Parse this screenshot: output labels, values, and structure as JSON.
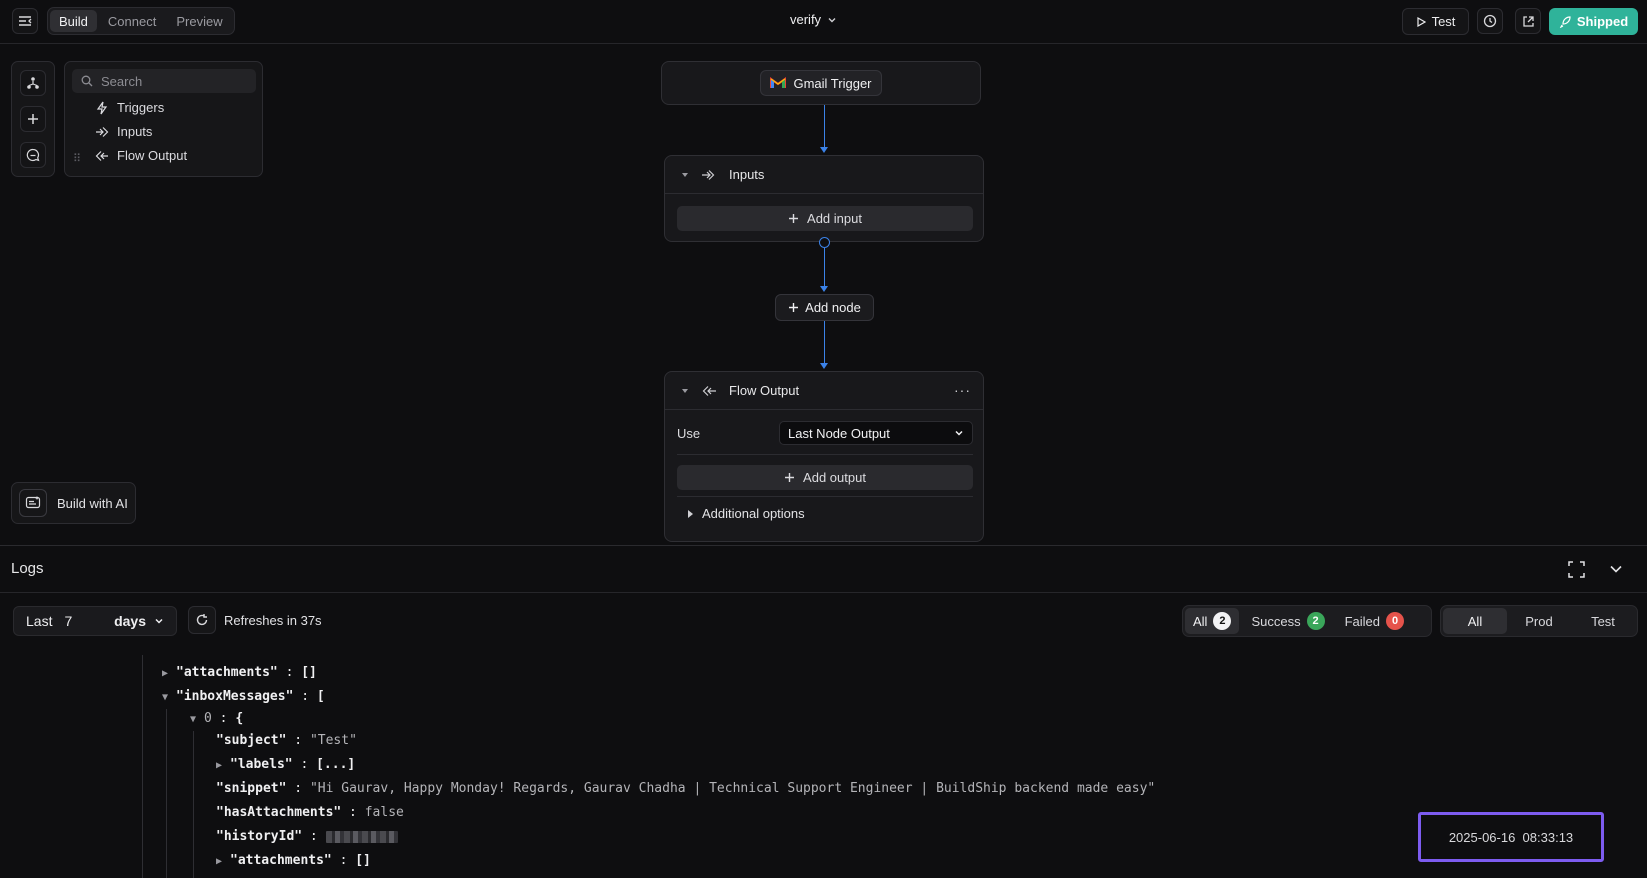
{
  "topbar": {
    "tabs": [
      "Build",
      "Connect",
      "Preview"
    ],
    "active_tab": "Build",
    "flow_name": "verify",
    "test_label": "Test",
    "shipped_label": "Shipped"
  },
  "sidebar": {
    "search_placeholder": "Search",
    "items": [
      {
        "label": "Triggers",
        "icon": "bolt-icon"
      },
      {
        "label": "Inputs",
        "icon": "input-arrow-icon"
      },
      {
        "label": "Flow Output",
        "icon": "output-arrow-icon"
      }
    ],
    "build_ai_label": "Build with AI"
  },
  "canvas": {
    "trigger_label": "Gmail Trigger",
    "inputs_node": {
      "title": "Inputs",
      "add_label": "Add input"
    },
    "add_node_label": "Add node",
    "output_node": {
      "title": "Flow Output",
      "use_label": "Use",
      "use_value": "Last Node Output",
      "add_label": "Add output",
      "options_label": "Additional options"
    }
  },
  "logs": {
    "title": "Logs",
    "range": {
      "prefix": "Last",
      "number": "7",
      "unit": "days"
    },
    "refresh_text": "Refreshes in 37s",
    "filters": [
      {
        "label": "All",
        "count": "2"
      },
      {
        "label": "Success",
        "count": "2"
      },
      {
        "label": "Failed",
        "count": "0"
      }
    ],
    "envs": [
      "All",
      "Prod",
      "Test"
    ],
    "active_env": "All",
    "json": {
      "attachments_key": "\"attachments\"",
      "attachments_val": "[]",
      "inbox_key": "\"inboxMessages\"",
      "inbox_open": "[",
      "index": "0",
      "obj_open": "{",
      "subject_key": "\"subject\"",
      "subject_val": "\"Test\"",
      "labels_key": "\"labels\"",
      "labels_val": "[...]",
      "snippet_key": "\"snippet\"",
      "snippet_val": "\"Hi Gaurav, Happy Monday! Regards, Gaurav Chadha | Technical Support Engineer | BuildShip backend made easy\"",
      "hasatt_key": "\"hasAttachments\"",
      "hasatt_val": "false",
      "history_key": "\"historyId\"",
      "attachments2_key": "\"attachments\"",
      "attachments2_val": "[]"
    },
    "timestamp": "2025-06-16  08:33:13"
  },
  "colors": {
    "accent": "#2fb39a",
    "wire": "#3b82e8",
    "highlight": "#7d5cf0",
    "success": "#3aa65a",
    "failed": "#e5534b"
  }
}
